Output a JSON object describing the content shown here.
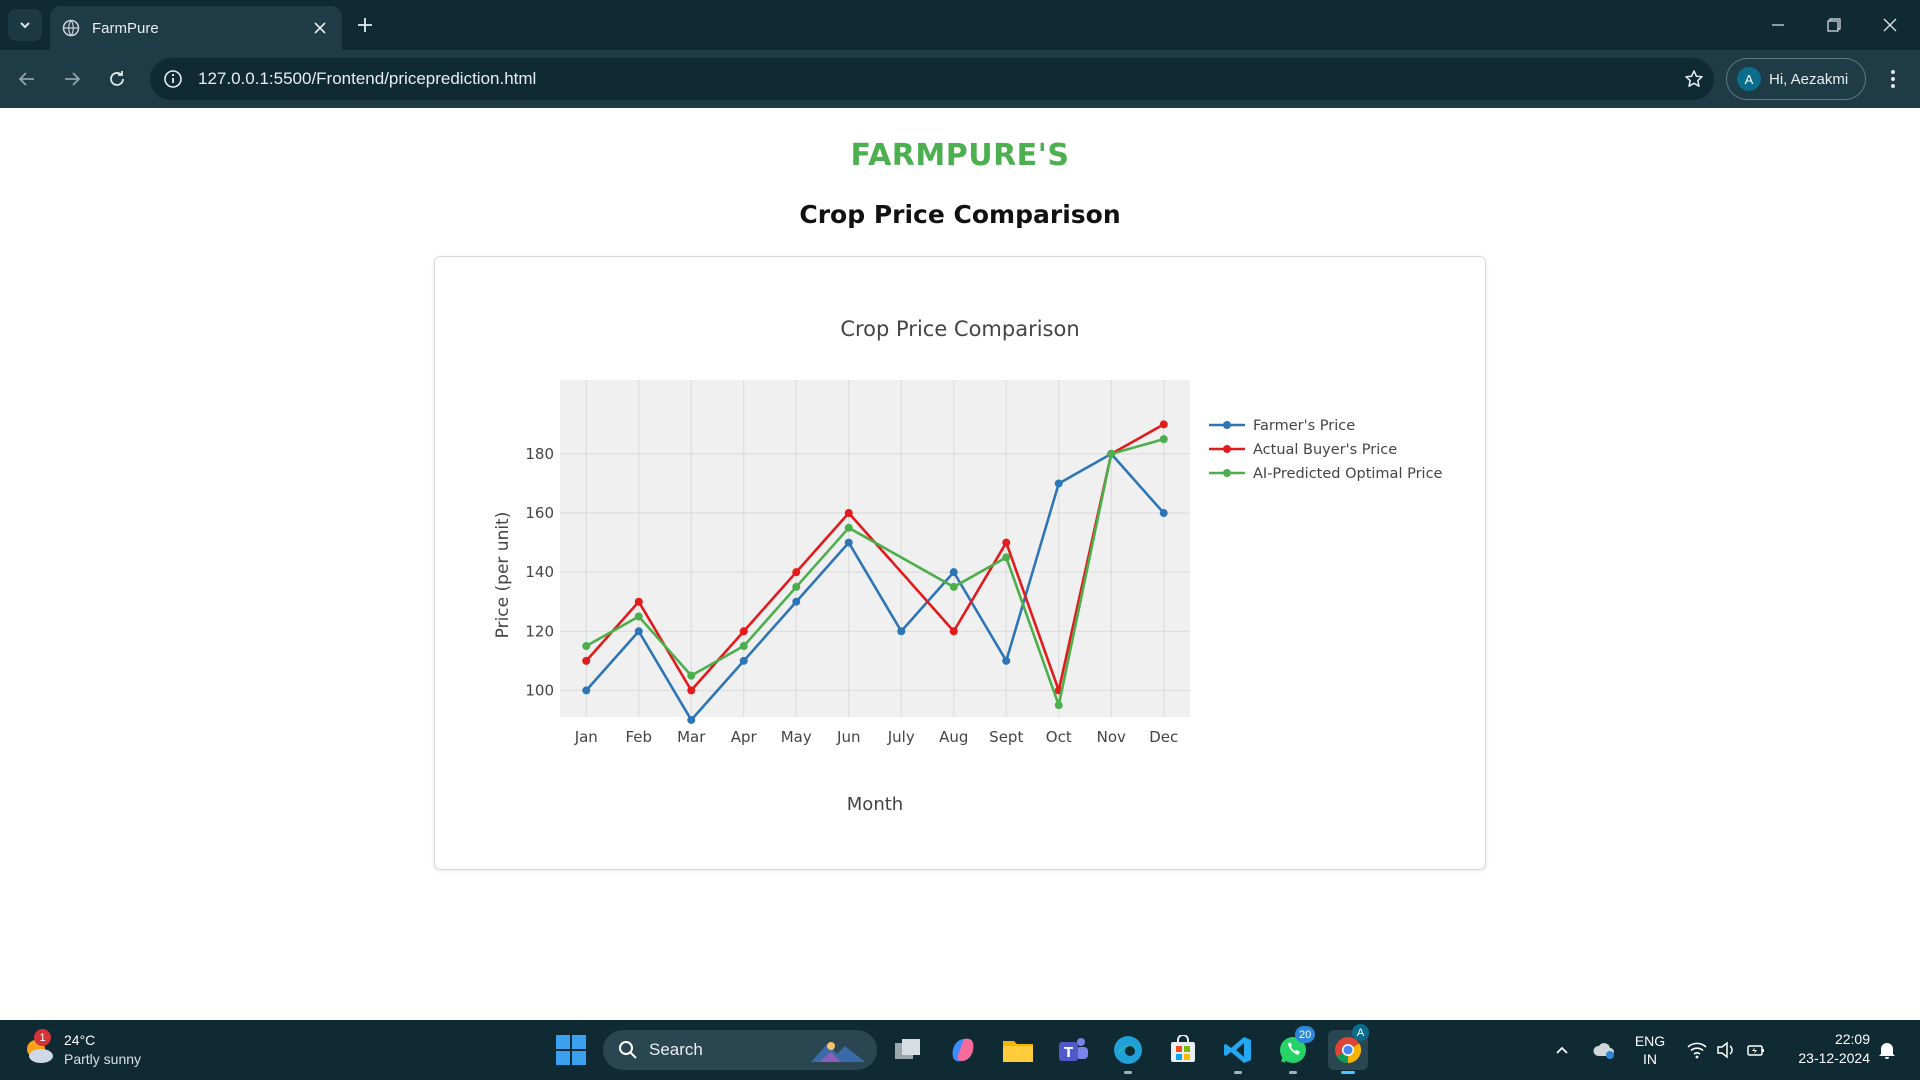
{
  "browser": {
    "tab_title": "FarmPure",
    "url": "127.0.0.1:5500/Frontend/priceprediction.html",
    "profile_label": "Hi, Aezakmi",
    "profile_initial": "A"
  },
  "page": {
    "brand": "FARMPURE'S",
    "heading": "Crop Price Comparison"
  },
  "chart_data": {
    "type": "line",
    "title": "Crop Price Comparison",
    "xlabel": "Month",
    "ylabel": "Price (per unit)",
    "categories": [
      "Jan",
      "Feb",
      "Mar",
      "Apr",
      "May",
      "Jun",
      "July",
      "Aug",
      "Sept",
      "Oct",
      "Nov",
      "Dec"
    ],
    "ylim": [
      91,
      205
    ],
    "yticks": [
      100,
      120,
      140,
      160,
      180
    ],
    "grid": true,
    "legend_position": "top-right",
    "series": [
      {
        "name": "Farmer's Price",
        "color": "#2e75b6",
        "values": [
          100,
          120,
          90,
          110,
          130,
          150,
          120,
          140,
          110,
          170,
          180,
          160
        ]
      },
      {
        "name": "Actual Buyer's Price",
        "color": "#e31a1c",
        "values": [
          110,
          130,
          100,
          120,
          140,
          160,
          null,
          120,
          150,
          100,
          180,
          190
        ]
      },
      {
        "name": "AI-Predicted Optimal Price",
        "color": "#4cae4c",
        "values": [
          115,
          125,
          105,
          115,
          135,
          155,
          null,
          135,
          145,
          95,
          180,
          185
        ]
      }
    ]
  },
  "taskbar": {
    "temperature": "24°C",
    "weather": "Partly sunny",
    "weather_badge": "1",
    "search_label": "Search",
    "whatsapp_badge": "20",
    "lang_top": "ENG",
    "lang_bottom": "IN",
    "time": "22:09",
    "date": "23-12-2024"
  }
}
